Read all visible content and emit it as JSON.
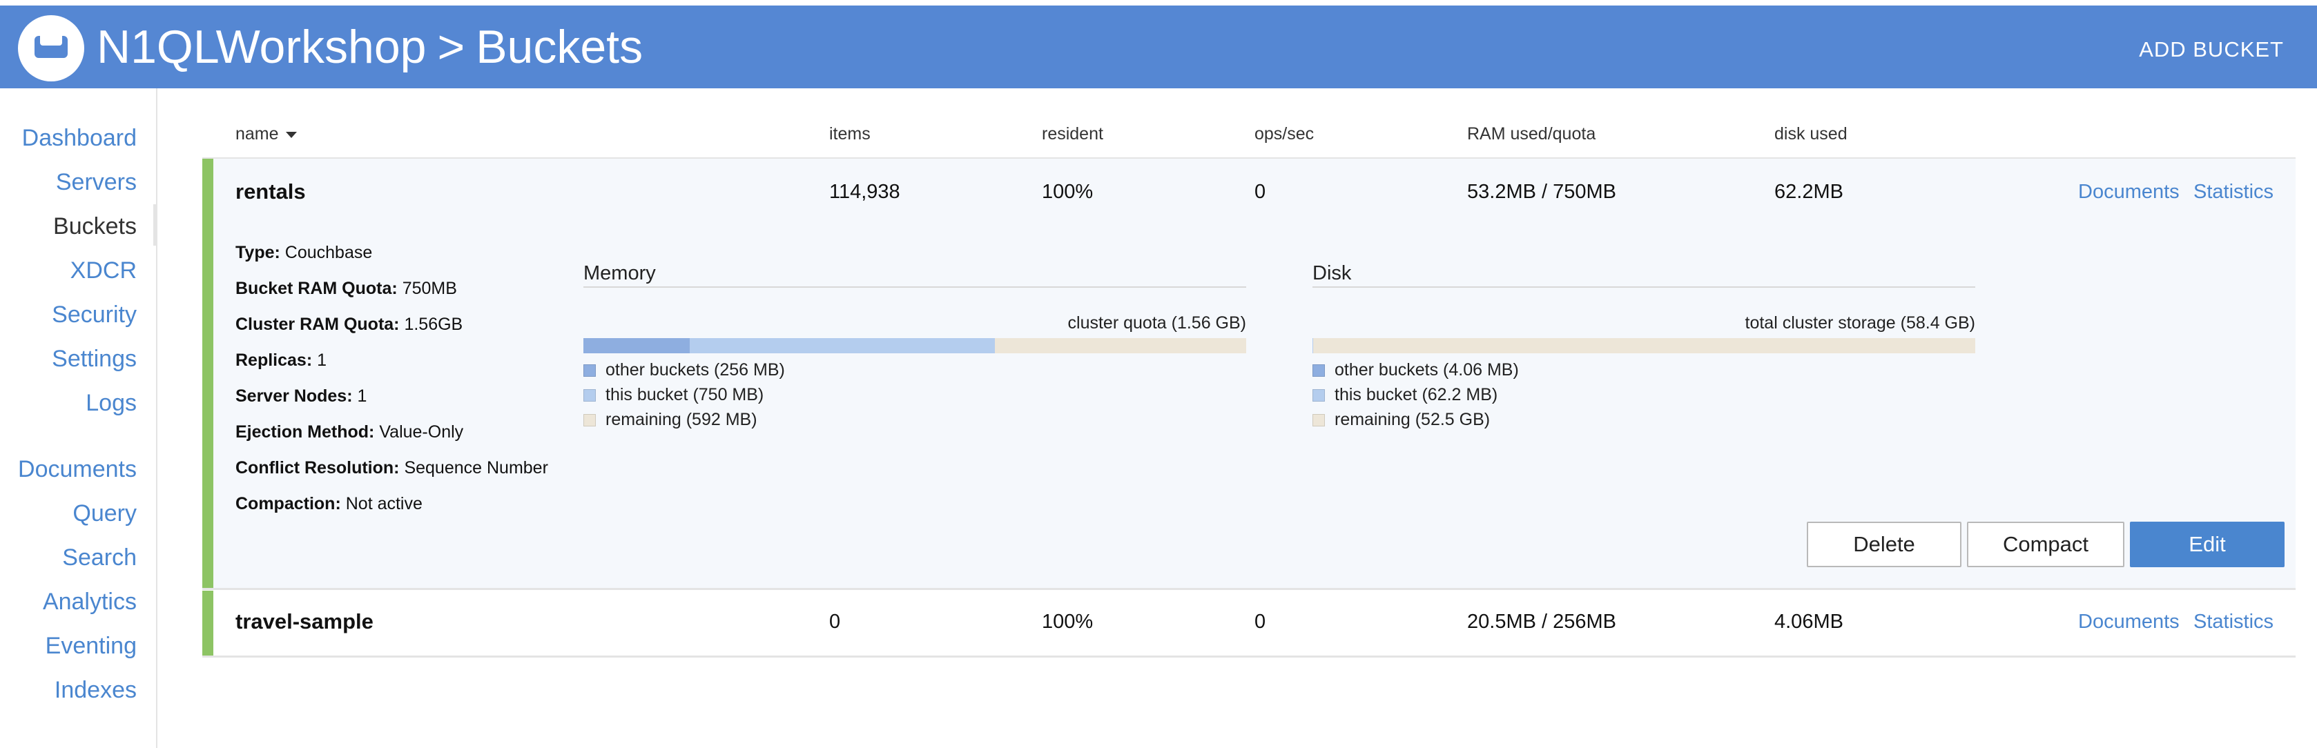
{
  "header": {
    "cluster_name": "N1QLWorkshop",
    "separator": ">",
    "page_title": "Buckets",
    "add_bucket_label": "ADD BUCKET"
  },
  "sidebar": {
    "items": [
      {
        "label": "Dashboard"
      },
      {
        "label": "Servers"
      },
      {
        "label": "Buckets"
      },
      {
        "label": "XDCR"
      },
      {
        "label": "Security"
      },
      {
        "label": "Settings"
      },
      {
        "label": "Logs"
      },
      {
        "label": "Documents"
      },
      {
        "label": "Query"
      },
      {
        "label": "Search"
      },
      {
        "label": "Analytics"
      },
      {
        "label": "Eventing"
      },
      {
        "label": "Indexes"
      }
    ],
    "active": "Buckets"
  },
  "table": {
    "columns": {
      "name": "name",
      "items": "items",
      "resident": "resident",
      "ops": "ops/sec",
      "ram": "RAM used/quota",
      "disk": "disk used"
    },
    "sort_column": "name",
    "rows": [
      {
        "name": "rentals",
        "items": "114,938",
        "resident": "100%",
        "ops": "0",
        "ram": "53.2MB / 750MB",
        "disk": "62.2MB",
        "documents_link": "Documents",
        "statistics_link": "Statistics",
        "expanded": true
      },
      {
        "name": "travel-sample",
        "items": "0",
        "resident": "100%",
        "ops": "0",
        "ram": "20.5MB / 256MB",
        "disk": "4.06MB",
        "documents_link": "Documents",
        "statistics_link": "Statistics",
        "expanded": false
      }
    ]
  },
  "details": {
    "props": [
      {
        "label": "Type:",
        "value": "Couchbase"
      },
      {
        "label": "Bucket RAM Quota:",
        "value": "750MB"
      },
      {
        "label": "Cluster RAM Quota:",
        "value": "1.56GB"
      },
      {
        "label": "Replicas:",
        "value": "1"
      },
      {
        "label": "Server Nodes:",
        "value": "1"
      },
      {
        "label": "Ejection Method:",
        "value": "Value-Only"
      },
      {
        "label": "Conflict Resolution:",
        "value": "Sequence Number"
      },
      {
        "label": "Compaction:",
        "value": "Not active"
      }
    ],
    "memory": {
      "title": "Memory",
      "caption": "cluster quota (1.56 GB)",
      "fractions": [
        0.16,
        0.46
      ],
      "legend": [
        "other buckets (256 MB)",
        "this bucket (750 MB)",
        "remaining (592 MB)"
      ]
    },
    "disk": {
      "title": "Disk",
      "caption": "total cluster storage (58.4 GB)",
      "fractions": [
        0.0001,
        0.001
      ],
      "legend": [
        "other buckets (4.06 MB)",
        "this bucket (62.2 MB)",
        "remaining (52.5 GB)"
      ]
    },
    "buttons": {
      "delete": "Delete",
      "compact": "Compact",
      "edit": "Edit"
    }
  },
  "colors": {
    "header_bg": "#5587d3",
    "link": "#4a86cf",
    "bucket_status": "#8dc464",
    "other_buckets": "#8eaee0",
    "this_bucket": "#b4cdee",
    "remaining": "#ede6d8"
  }
}
